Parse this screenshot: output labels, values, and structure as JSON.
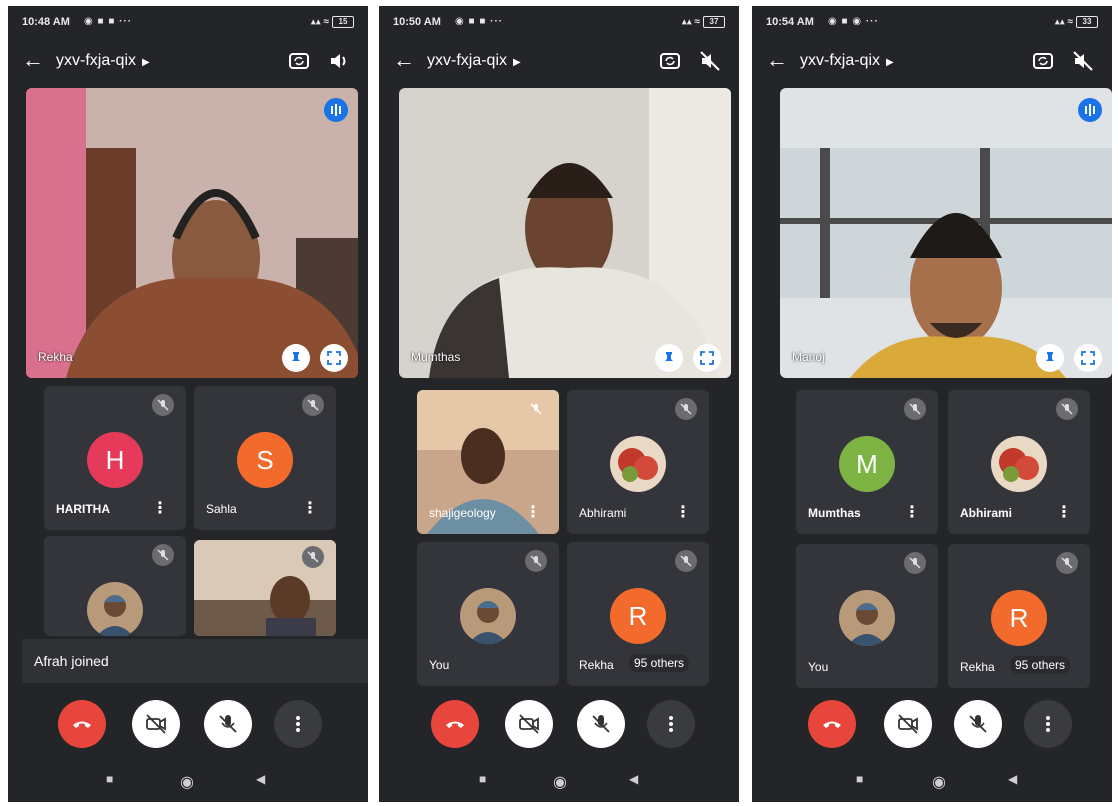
{
  "meeting_code": "yxv-fxja-qix",
  "colors": {
    "background": "#242529",
    "tile": "#34353a",
    "end_call": "#e8453c",
    "accent": "#1a73e8",
    "avatar_h": "#e63a5b",
    "avatar_s": "#f26b2c",
    "avatar_r": "#f26b2c",
    "avatar_m": "#7cb342"
  },
  "icons": {
    "back": "arrow-left-icon",
    "switch_camera": "switch-camera-icon",
    "speaker": "speaker-icon",
    "speaker_off": "speaker-off-icon",
    "pin": "pin-icon",
    "fullscreen": "fullscreen-icon",
    "mic_off": "mic-off-icon",
    "video_off": "video-off-icon",
    "end_call": "phone-hangup-icon",
    "more": "more-vertical-icon"
  },
  "phones": [
    {
      "time": "10:48 AM",
      "battery": "15",
      "main": {
        "name": "Rekha"
      },
      "tiles": [
        {
          "name": "HARITHA",
          "initial": "H"
        },
        {
          "name": "Sahla",
          "initial": "S"
        }
      ],
      "toast": "Afrah joined"
    },
    {
      "time": "10:50 AM",
      "battery": "37",
      "main": {
        "name": "Mumthas"
      },
      "tiles": [
        {
          "name": "shajigeology"
        },
        {
          "name": "Abhirami"
        },
        {
          "name": "You"
        },
        {
          "name": "Rekha",
          "initial": "R",
          "others": "95 others"
        }
      ]
    },
    {
      "time": "10:54 AM",
      "battery": "33",
      "main": {
        "name": "Manoj"
      },
      "tiles": [
        {
          "name": "Mumthas",
          "initial": "M"
        },
        {
          "name": "Abhirami"
        },
        {
          "name": "You"
        },
        {
          "name": "Rekha",
          "initial": "R",
          "others": "95 others"
        }
      ]
    }
  ]
}
